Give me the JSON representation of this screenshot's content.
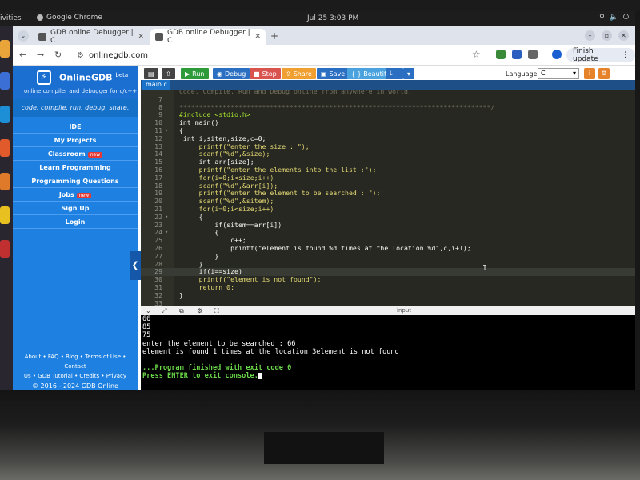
{
  "topbar": {
    "activities": "ivities",
    "app_indicator": "Google Chrome",
    "clock": "Jul 25  3:03 PM"
  },
  "browser": {
    "tabs": [
      {
        "title": "GDB online Debugger | C"
      },
      {
        "title": "GDB online Debugger | C"
      }
    ],
    "url": "onlinegdb.com",
    "finish_update": "Finish update"
  },
  "sidebar": {
    "brand": "OnlineGDB",
    "brand_sup": "beta",
    "subtitle": "online compiler and debugger for c/c++",
    "tagline": "code. compile. run. debug. share.",
    "menu": [
      {
        "label": "IDE",
        "badge": ""
      },
      {
        "label": "My Projects",
        "badge": ""
      },
      {
        "label": "Classroom",
        "badge": "new"
      },
      {
        "label": "Learn Programming",
        "badge": ""
      },
      {
        "label": "Programming Questions",
        "badge": ""
      },
      {
        "label": "Jobs",
        "badge": "new"
      },
      {
        "label": "Sign Up",
        "badge": ""
      },
      {
        "label": "Login",
        "badge": ""
      }
    ],
    "footer_line1": "About • FAQ • Blog • Terms of Use • Contact",
    "footer_line2": "Us • GDB Tutorial • Credits • Privacy",
    "copyright": "© 2016 - 2024 GDB Online"
  },
  "toolbar": {
    "run": "Run",
    "debug": "Debug",
    "stop": "Stop",
    "share": "Share",
    "save": "Save",
    "beautify": "{ } Beautify",
    "language_label": "Language",
    "language_value": "C",
    "colors": {
      "run": "#2e9b3a",
      "debug": "#2a6fc2",
      "stop": "#d9534f",
      "share": "#f0a030",
      "save": "#2a6fc2",
      "beautify": "#4aa3df",
      "download": "#2a6fc2"
    }
  },
  "editor": {
    "file": "main.c",
    "lines": [
      {
        "n": "",
        "fold": "",
        "text": "Code, Compile, Run and Debug online from anywhere in world.",
        "cls": "comment"
      },
      {
        "n": "7",
        "fold": "",
        "text": "",
        "cls": ""
      },
      {
        "n": "8",
        "fold": "",
        "text": "*******************************************************************************/",
        "cls": "comment"
      },
      {
        "n": "9",
        "fold": "",
        "text": "#include <stdio.h>",
        "cls": "pre"
      },
      {
        "n": "10",
        "fold": "",
        "text": "int main()",
        "cls": ""
      },
      {
        "n": "11",
        "fold": "▾",
        "text": "{",
        "cls": ""
      },
      {
        "n": "12",
        "fold": "",
        "text": " int i,siten,size,c=0;",
        "cls": ""
      },
      {
        "n": "13",
        "fold": "",
        "text": "     printf(\"enter the size : \");",
        "cls": "fn"
      },
      {
        "n": "14",
        "fold": "",
        "text": "     scanf(\"%d\",&size);",
        "cls": "fn"
      },
      {
        "n": "15",
        "fold": "",
        "text": "     int arr[size];",
        "cls": ""
      },
      {
        "n": "16",
        "fold": "",
        "text": "     printf(\"enter the elements into the list :\");",
        "cls": "fn"
      },
      {
        "n": "17",
        "fold": "",
        "text": "     for(i=0;i<size;i++)",
        "cls": "fn"
      },
      {
        "n": "18",
        "fold": "",
        "text": "     scanf(\"%d\",&arr[i]);",
        "cls": "fn"
      },
      {
        "n": "19",
        "fold": "",
        "text": "     printf(\"enter the element to be searched : \");",
        "cls": "fn"
      },
      {
        "n": "20",
        "fold": "",
        "text": "     scanf(\"%d\",&sitem);",
        "cls": "fn"
      },
      {
        "n": "21",
        "fold": "",
        "text": "     for(i=0;i<size;i++)",
        "cls": "fn"
      },
      {
        "n": "22",
        "fold": "▾",
        "text": "     {",
        "cls": ""
      },
      {
        "n": "23",
        "fold": "",
        "text": "         if(sitem==arr[i])",
        "cls": ""
      },
      {
        "n": "24",
        "fold": "▾",
        "text": "         {",
        "cls": ""
      },
      {
        "n": "25",
        "fold": "",
        "text": "             c++;",
        "cls": ""
      },
      {
        "n": "26",
        "fold": "",
        "text": "             printf(\"element is found %d times at the location %d\",c,i+1);",
        "cls": ""
      },
      {
        "n": "27",
        "fold": "",
        "text": "         }",
        "cls": ""
      },
      {
        "n": "28",
        "fold": "",
        "text": "     }",
        "cls": ""
      },
      {
        "n": "29",
        "fold": "",
        "text": "     if(i==size)",
        "cls": "hl"
      },
      {
        "n": "30",
        "fold": "",
        "text": "     printf(\"element is not found\");",
        "cls": "fn"
      },
      {
        "n": "31",
        "fold": "",
        "text": "     return 0;",
        "cls": "fn"
      },
      {
        "n": "32",
        "fold": "",
        "text": "}",
        "cls": ""
      },
      {
        "n": "33",
        "fold": "",
        "text": "",
        "cls": ""
      }
    ]
  },
  "io": {
    "label": "input"
  },
  "console": {
    "lines": [
      {
        "text": "66",
        "cls": ""
      },
      {
        "text": "85",
        "cls": ""
      },
      {
        "text": "75",
        "cls": ""
      },
      {
        "text": "enter the element to be searched : 66",
        "cls": ""
      },
      {
        "text": "element is found 1 times at the location 3element is not found",
        "cls": ""
      },
      {
        "text": "",
        "cls": "blank"
      },
      {
        "text": "...Program finished with exit code 0",
        "cls": "green"
      },
      {
        "text": "Press ENTER to exit console.",
        "cls": "green"
      }
    ]
  }
}
